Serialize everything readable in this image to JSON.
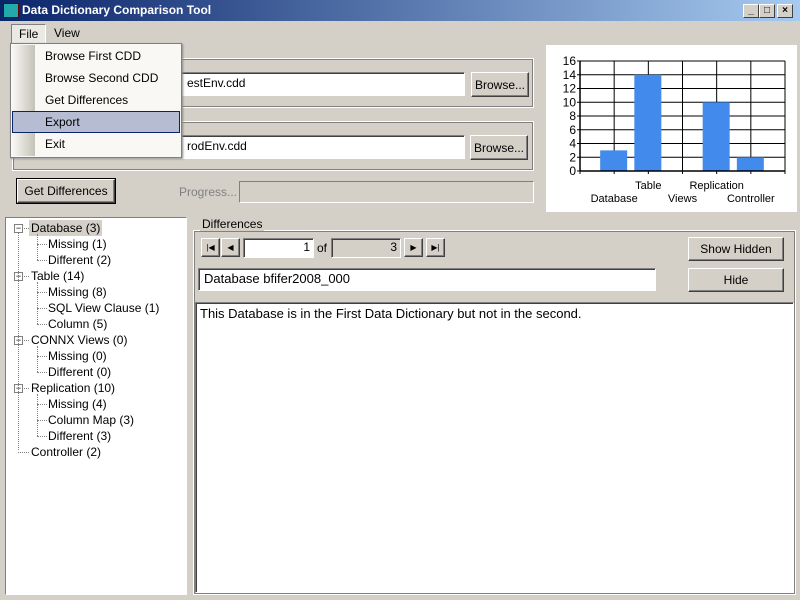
{
  "window": {
    "title": "Data Dictionary Comparison Tool",
    "controls": [
      "_",
      "□",
      "×"
    ]
  },
  "menu": {
    "items": [
      "File",
      "View"
    ],
    "file_menu": [
      "Browse First CDD",
      "Browse Second CDD",
      "Get Differences",
      "Export",
      "Exit"
    ],
    "highlighted": "Export"
  },
  "first_cdd": {
    "path_visible": "estEnv.cdd",
    "browse_label": "Browse..."
  },
  "second_cdd": {
    "path_visible": "rodEnv.cdd",
    "browse_label": "Browse..."
  },
  "get_differences_label": "Get Differences",
  "progress": {
    "label": "Progress...",
    "value": 0
  },
  "tree": [
    {
      "label": "Database (3)",
      "selected": true,
      "children": [
        "Missing (1)",
        "Different (2)"
      ]
    },
    {
      "label": "Table (14)",
      "children": [
        "Missing (8)",
        "SQL View Clause (1)",
        "Column (5)"
      ]
    },
    {
      "label": "CONNX Views (0)",
      "children": [
        "Missing (0)",
        "Different (0)"
      ]
    },
    {
      "label": "Replication (10)",
      "children": [
        "Missing (4)",
        "Column Map (3)",
        "Different (3)"
      ]
    },
    {
      "label": "Controller (2)",
      "children": []
    }
  ],
  "differences": {
    "group_label": "Differences",
    "current": "1",
    "of_label": "of",
    "total": "3",
    "show_hidden_label": "Show Hidden",
    "hide_label": "Hide",
    "item_name": "Database bfifer2008_000",
    "description": "This Database is in the First Data Dictionary but not in the second."
  },
  "chart_data": {
    "type": "bar",
    "categories": [
      "Database",
      "Table",
      "Views",
      "Replication",
      "Controller"
    ],
    "values": [
      3,
      14,
      0,
      10,
      2
    ],
    "ylim": [
      0,
      16
    ],
    "yticks": [
      0,
      2,
      4,
      6,
      8,
      10,
      12,
      14,
      16
    ],
    "grid": true,
    "bar_color": "#428bec"
  }
}
